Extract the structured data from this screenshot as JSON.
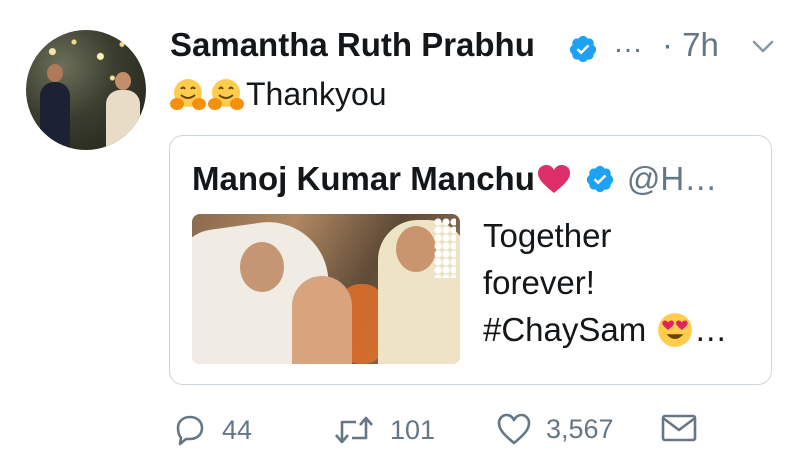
{
  "author": {
    "name": "Samantha Ruth Prabhu",
    "ellipsis": "…",
    "time": "· 7h"
  },
  "tweet": {
    "emoji": [
      "hugging-face",
      "hugging-face"
    ],
    "text": "Thankyou"
  },
  "quote": {
    "name": "Manoj Kumar Manchu",
    "heart_emoji": "heart",
    "handle": "@H…",
    "lines": [
      "Together",
      "forever!",
      "#ChaySam"
    ],
    "trailing": "…"
  },
  "actions": {
    "replies": "44",
    "retweets": "101",
    "likes": "3,567"
  },
  "colors": {
    "verified": "#1da1f2",
    "muted": "#657786",
    "text": "#14171a",
    "heart": "#e0245e"
  },
  "icons": [
    "verified-badge-icon",
    "chevron-down-icon",
    "reply-icon",
    "retweet-icon",
    "like-icon",
    "direct-message-icon"
  ]
}
